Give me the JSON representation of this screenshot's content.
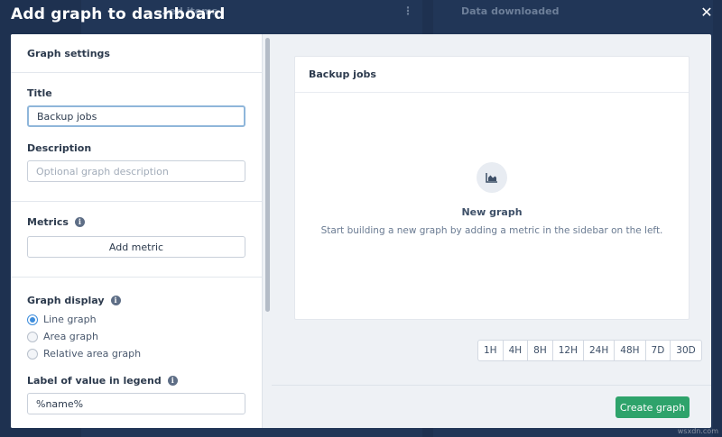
{
  "modal": {
    "title": "Add graph to dashboard",
    "close_glyph": "✕"
  },
  "background": {
    "col1_title": "...ed items",
    "col2_title": "Data downloaded"
  },
  "sidebar": {
    "settings_heading": "Graph settings",
    "title_label": "Title",
    "title_value": "Backup jobs",
    "description_label": "Description",
    "description_placeholder": "Optional graph description",
    "metrics_label": "Metrics",
    "add_metric_label": "Add metric",
    "display_label": "Graph display",
    "display_options": [
      {
        "label": "Line graph",
        "checked": true
      },
      {
        "label": "Area graph",
        "checked": false
      },
      {
        "label": "Relative area graph",
        "checked": false
      }
    ],
    "legend_label": "Label of value in legend",
    "legend_value": "%name%"
  },
  "preview": {
    "card_title": "Backup jobs",
    "empty_title": "New graph",
    "empty_description": "Start building a new graph by adding a metric in the sidebar on the left.",
    "time_ranges": [
      "1H",
      "4H",
      "8H",
      "12H",
      "24H",
      "48H",
      "7D",
      "30D"
    ],
    "create_button": "Create graph"
  },
  "colors": {
    "overlay": "#1e3150",
    "primary_green": "#2ea36b",
    "radio_blue": "#3d8ddc"
  },
  "watermark": "wsxdn.com"
}
